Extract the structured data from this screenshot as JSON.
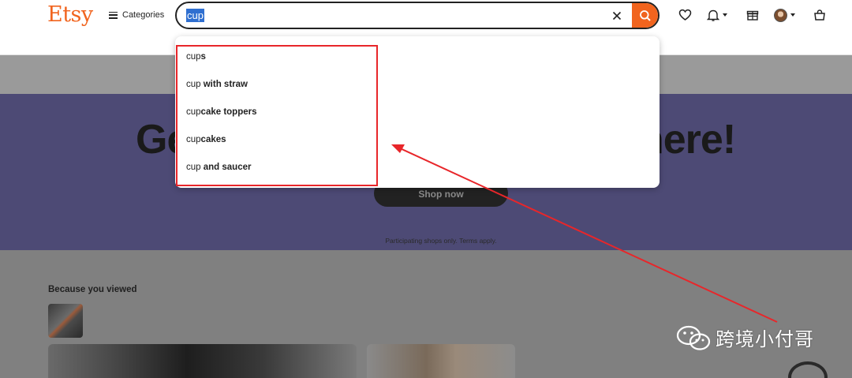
{
  "header": {
    "logo": "Etsy",
    "categories_label": "Categories",
    "search_value": "cup"
  },
  "suggestions": [
    {
      "typed": "cup",
      "rest": "s"
    },
    {
      "typed": "cup",
      "rest": " with straw"
    },
    {
      "typed": "cup",
      "rest": "cake toppers"
    },
    {
      "typed": "cup",
      "rest": "cakes"
    },
    {
      "typed": "cup",
      "rest": " and saucer"
    }
  ],
  "hero": {
    "headline_left": "Ge",
    "headline_right": "here!",
    "cta_label": "Shop now",
    "fine_print": "Participating shops only. Terms apply."
  },
  "recommendations": {
    "title": "Because you viewed"
  },
  "watermark": {
    "text": "跨境小付哥"
  },
  "colors": {
    "brand_orange": "#f1641e",
    "annotation_red": "#e8262a",
    "hero_purple": "#4d4a75",
    "selection_blue": "#2f6fd0"
  },
  "icons": [
    "hamburger-icon",
    "clear-icon",
    "search-icon",
    "heart-icon",
    "bell-icon",
    "gift-icon",
    "cart-icon",
    "wechat-icon"
  ]
}
